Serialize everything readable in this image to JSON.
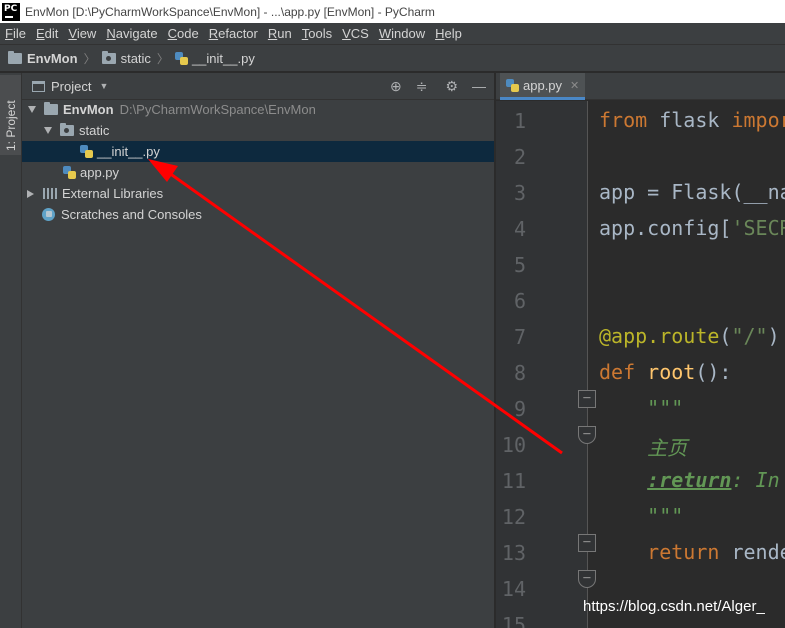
{
  "window": {
    "title": "EnvMon [D:\\PyCharmWorkSpance\\EnvMon] - ...\\app.py [EnvMon] - PyCharm",
    "logo_text": "PC"
  },
  "menu": [
    "File",
    "Edit",
    "View",
    "Navigate",
    "Code",
    "Refactor",
    "Run",
    "Tools",
    "VCS",
    "Window",
    "Help"
  ],
  "breadcrumb": {
    "project": "EnvMon",
    "folder": "static",
    "file": "__init__.py"
  },
  "sidebar": {
    "tab_label": "1: Project"
  },
  "project_panel": {
    "title": "Project",
    "tree": {
      "root": {
        "name": "EnvMon",
        "path": "D:\\PyCharmWorkSpance\\EnvMon"
      },
      "static_folder": "static",
      "init_file": "__init__.py",
      "app_file": "app.py",
      "external_libraries": "External Libraries",
      "scratches": "Scratches and Consoles"
    }
  },
  "editor": {
    "tab_label": "app.py",
    "line_numbers": [
      "1",
      "2",
      "3",
      "4",
      "5",
      "6",
      "7",
      "8",
      "9",
      "10",
      "11",
      "12",
      "13",
      "14",
      "15"
    ],
    "code": {
      "l1_from": "from",
      "l1_mid": " flask ",
      "l1_import": "impor",
      "l3": "app = Flask(__na",
      "l4_a": "app.config[",
      "l4_b": "'SECR",
      "l7_a": "@app.route",
      "l7_b": "(",
      "l7_c": "\"/\"",
      "l7_d": ")",
      "l8_def": "def",
      "l8_sp": " ",
      "l8_fn": "root",
      "l8_end": "():",
      "l9": "    \"\"\"",
      "l10": "    主页",
      "l11_indent": "    ",
      "l11_tag": ":return",
      "l11_rest": ": In",
      "l12": "    \"\"\"",
      "l13_kw": "    return",
      "l13_rest": " rende"
    }
  },
  "watermark": "https://blog.csdn.net/Alger_",
  "colors": {
    "arrow": "#ff0000",
    "selection": "#0d293e",
    "keyword": "#cc7832",
    "docstring": "#629755"
  }
}
